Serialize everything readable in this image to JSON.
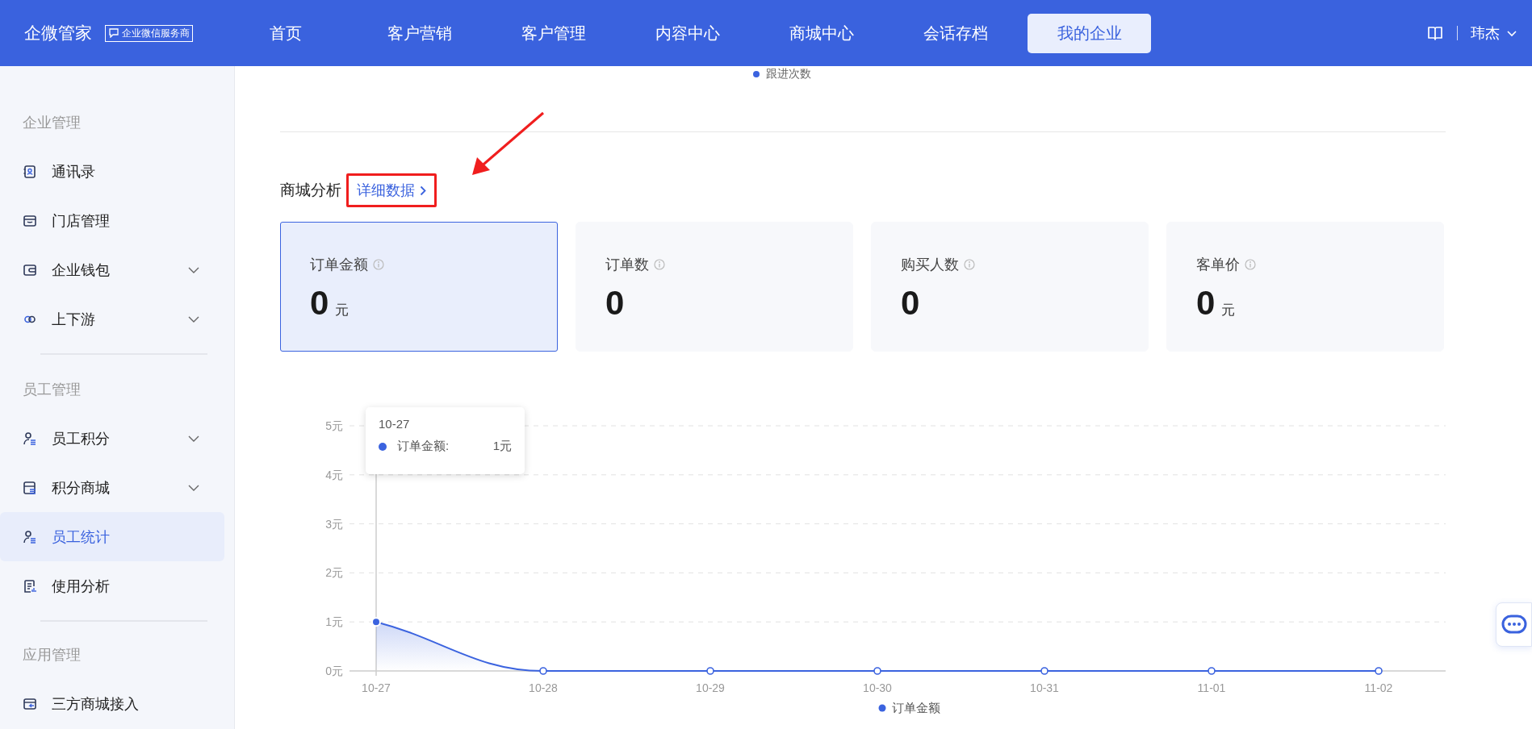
{
  "header": {
    "logo": "企微管家",
    "badge": "企业微信服务商",
    "nav": [
      {
        "label": "首页",
        "selected": false
      },
      {
        "label": "客户营销",
        "selected": false
      },
      {
        "label": "客户管理",
        "selected": false
      },
      {
        "label": "内容中心",
        "selected": false
      },
      {
        "label": "商城中心",
        "selected": false
      },
      {
        "label": "会话存档",
        "selected": false
      },
      {
        "label": "我的企业",
        "selected": true
      }
    ],
    "user": "玮杰"
  },
  "sidebar": {
    "groups": [
      {
        "title": "企业管理",
        "items": [
          {
            "label": "通讯录",
            "expandable": false,
            "selected": false
          },
          {
            "label": "门店管理",
            "expandable": false,
            "selected": false
          },
          {
            "label": "企业钱包",
            "expandable": true,
            "selected": false
          },
          {
            "label": "上下游",
            "expandable": true,
            "selected": false
          }
        ]
      },
      {
        "title": "员工管理",
        "items": [
          {
            "label": "员工积分",
            "expandable": true,
            "selected": false
          },
          {
            "label": "积分商城",
            "expandable": true,
            "selected": false
          },
          {
            "label": "员工统计",
            "expandable": false,
            "selected": true
          },
          {
            "label": "使用分析",
            "expandable": false,
            "selected": false
          }
        ]
      },
      {
        "title": "应用管理",
        "items": [
          {
            "label": "三方商城接入",
            "expandable": false,
            "selected": false
          }
        ]
      }
    ]
  },
  "top_legend": {
    "label": "跟进次数"
  },
  "mall_analysis": {
    "title": "商城分析",
    "link": "详细数据",
    "cards": [
      {
        "label": "订单金额",
        "value": "0",
        "unit": "元",
        "selected": true
      },
      {
        "label": "订单数",
        "value": "0",
        "selected": false
      },
      {
        "label": "购买人数",
        "value": "0",
        "selected": false
      },
      {
        "label": "客单价",
        "value": "0",
        "unit": "元",
        "selected": false
      }
    ],
    "chart_data": {
      "type": "area",
      "categories": [
        "10-27",
        "10-28",
        "10-29",
        "10-30",
        "10-31",
        "11-01",
        "11-02"
      ],
      "series": [
        {
          "name": "订单金额",
          "color": "#3b63df",
          "values": [
            1,
            0,
            0,
            0,
            0,
            0,
            0
          ]
        }
      ],
      "ylim": [
        0,
        5
      ],
      "grid": true,
      "ref_lines": [
        {
          "axis": "x",
          "value": "10-27"
        }
      ],
      "yticks": [
        {
          "value": 0,
          "label": "0元"
        },
        {
          "value": 1,
          "label": "1元"
        },
        {
          "value": 2,
          "label": "2元"
        },
        {
          "value": 3,
          "label": "3元"
        },
        {
          "value": 4,
          "label": "4元"
        },
        {
          "value": 5,
          "label": "5元"
        }
      ]
    },
    "tooltip": {
      "title": "10-27",
      "label": "订单金额:",
      "value": "1元"
    }
  }
}
